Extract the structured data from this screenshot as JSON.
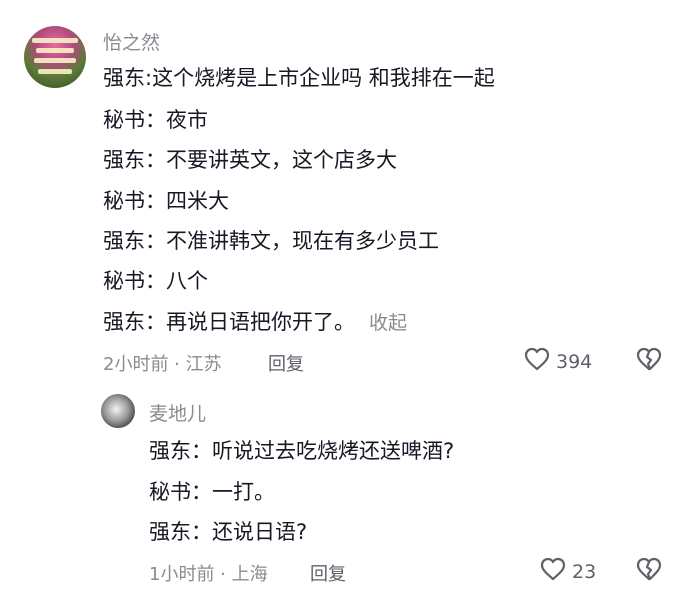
{
  "main_comment": {
    "username": "怡之然",
    "lines": [
      "强东:这个烧烤是上市企业吗 和我排在一起",
      "秘书：夜市",
      "强东：不要讲英文，这个店多大",
      "秘书：四米大",
      "强东：不准讲韩文，现在有多少员工",
      "秘书：八个",
      "强东：再说日语把你开了。"
    ],
    "collapse_label": "收起",
    "meta": "2小时前 · 江苏",
    "reply_label": "回复",
    "like_count": "394"
  },
  "reply_comment": {
    "username": "麦地儿",
    "lines": [
      "强东：听说过去吃烧烤还送啤酒?",
      "秘书：一打。",
      "强东：还说日语?"
    ],
    "meta": "1小时前 · 上海",
    "reply_label": "回复",
    "like_count": "23"
  },
  "icons": {
    "like": "heart-outline-icon",
    "dislike": "broken-heart-icon"
  }
}
